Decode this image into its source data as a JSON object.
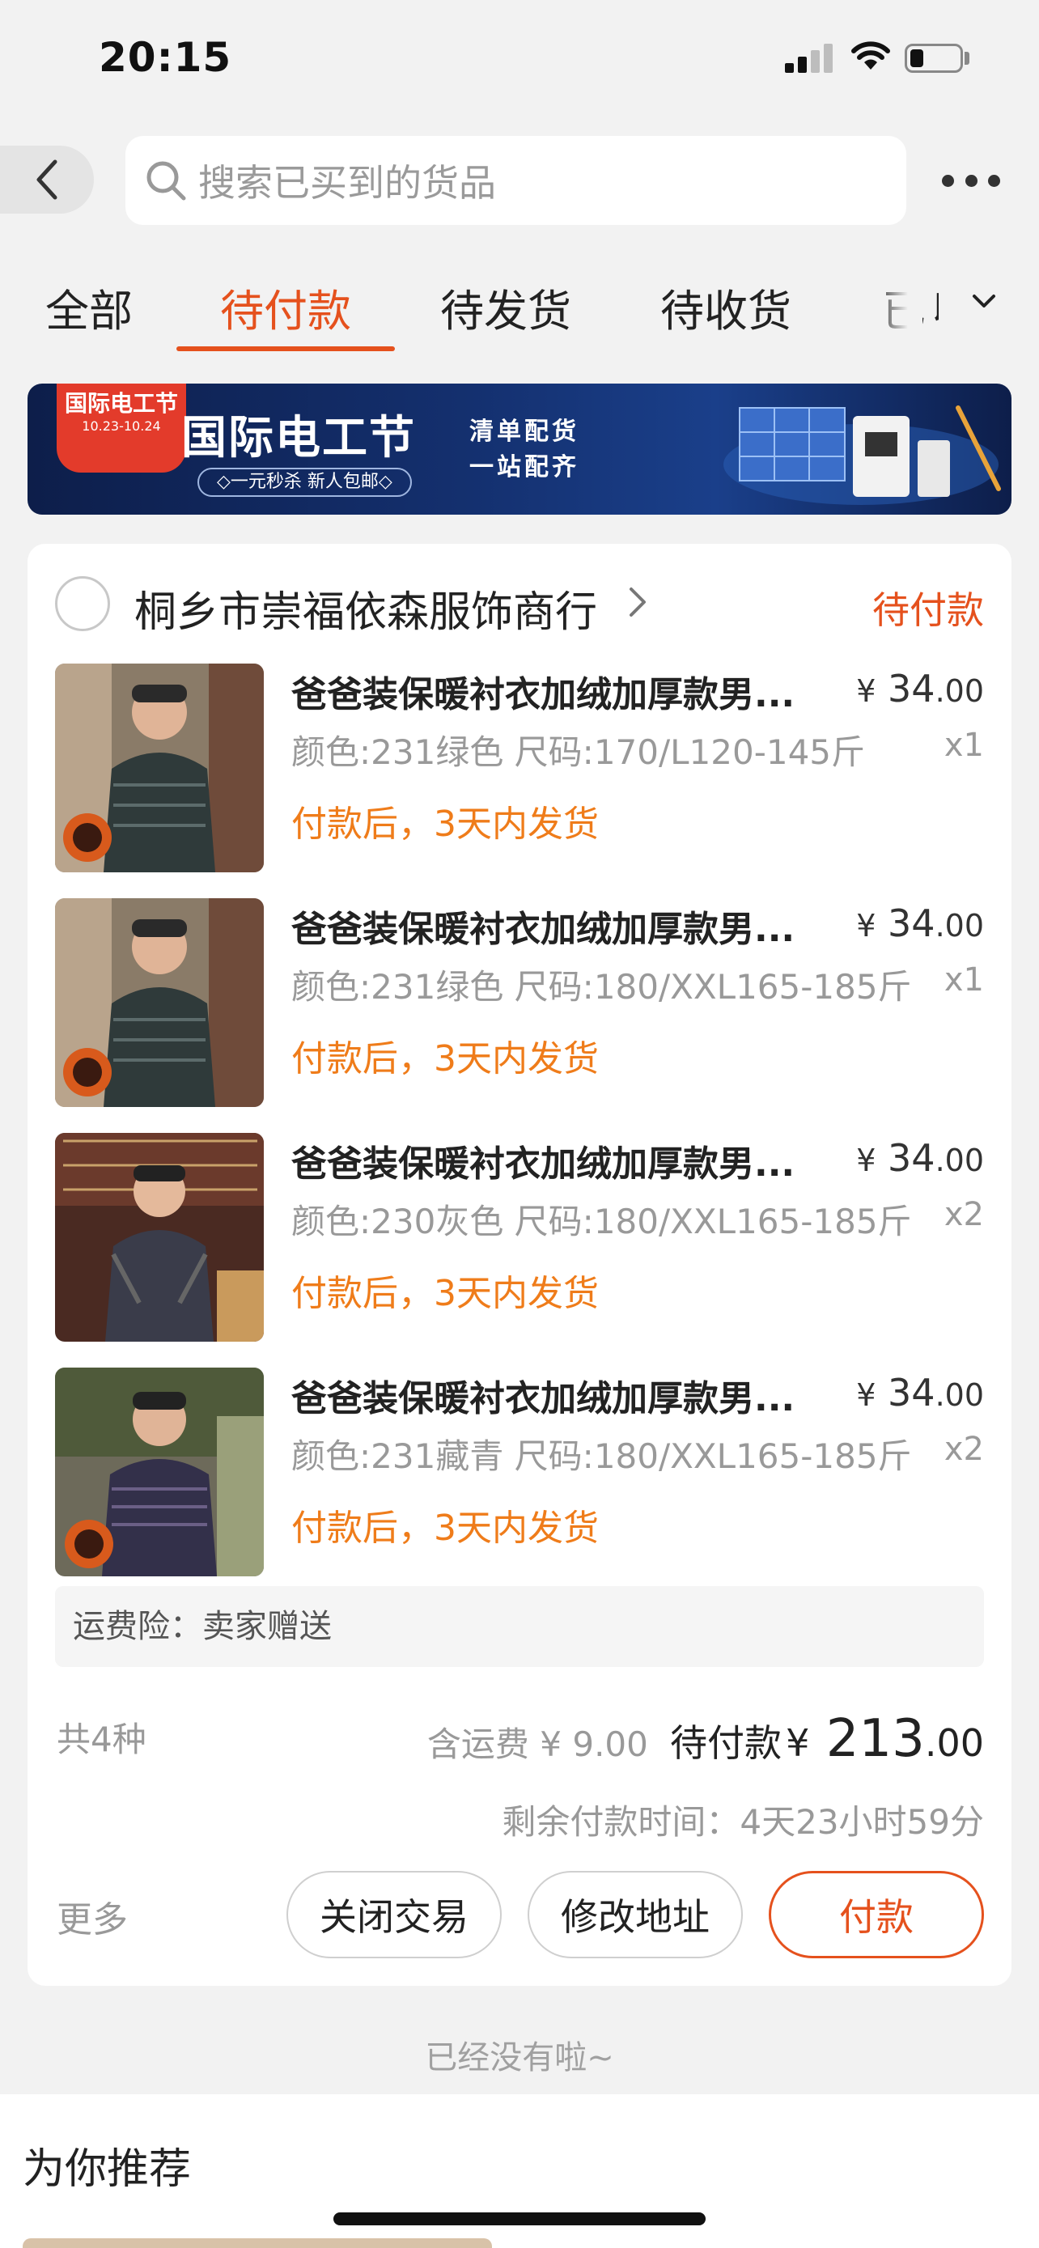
{
  "status_bar": {
    "time": "20:15"
  },
  "search": {
    "placeholder": "搜索已买到的货品"
  },
  "tabs": [
    {
      "label": "全部",
      "active": false
    },
    {
      "label": "待付款",
      "active": true
    },
    {
      "label": "待发货",
      "active": false
    },
    {
      "label": "待收货",
      "active": false
    },
    {
      "label": "已ㄐ",
      "active": false
    }
  ],
  "banner": {
    "badge_title": "国际电工节",
    "badge_dates": "10.23-10.24",
    "title": "国际电工节",
    "subtitle": "◇一元秒杀 新人包邮◇",
    "tagline_1": "清单配货",
    "tagline_2": "一站配齐"
  },
  "order": {
    "shop_name": "桐乡市崇福依森服饰商行",
    "status": "待付款",
    "items": [
      {
        "title": "爸爸装保暖衬衣加绒加厚款男...",
        "price_yen": "¥",
        "price_int": "34",
        "price_dec": ".00",
        "spec": "颜色:231绿色 尺码:170/L120-145斤",
        "qty": "x1",
        "ship_note": "付款后，3天内发货"
      },
      {
        "title": "爸爸装保暖衬衣加绒加厚款男...",
        "price_yen": "¥",
        "price_int": "34",
        "price_dec": ".00",
        "spec": "颜色:231绿色 尺码:180/XXL165-185斤",
        "qty": "x1",
        "ship_note": "付款后，3天内发货"
      },
      {
        "title": "爸爸装保暖衬衣加绒加厚款男...",
        "price_yen": "¥",
        "price_int": "34",
        "price_dec": ".00",
        "spec": "颜色:230灰色 尺码:180/XXL165-185斤",
        "qty": "x2",
        "ship_note": "付款后，3天内发货"
      },
      {
        "title": "爸爸装保暖衬衣加绒加厚款男...",
        "price_yen": "¥",
        "price_int": "34",
        "price_dec": ".00",
        "spec": "颜色:231藏青 尺码:180/XXL165-185斤",
        "qty": "x2",
        "ship_note": "付款后，3天内发货"
      }
    ],
    "insurance": "运费险：卖家赠送",
    "count": "共4种",
    "shipping_fee": "含运费 ¥ 9.00",
    "due_label": "待付款",
    "due_yen": "¥",
    "due_int": "213",
    "due_dec": ".00",
    "remaining": "剩余付款时间：4天23小时59分",
    "more": "更多",
    "buttons": {
      "close": "关闭交易",
      "address": "修改地址",
      "pay": "付款"
    }
  },
  "end_text": "已经没有啦~",
  "recommend_title": "为你推荐",
  "colors": {
    "accent": "#e5511d",
    "ship_note": "#ef7c1a"
  }
}
